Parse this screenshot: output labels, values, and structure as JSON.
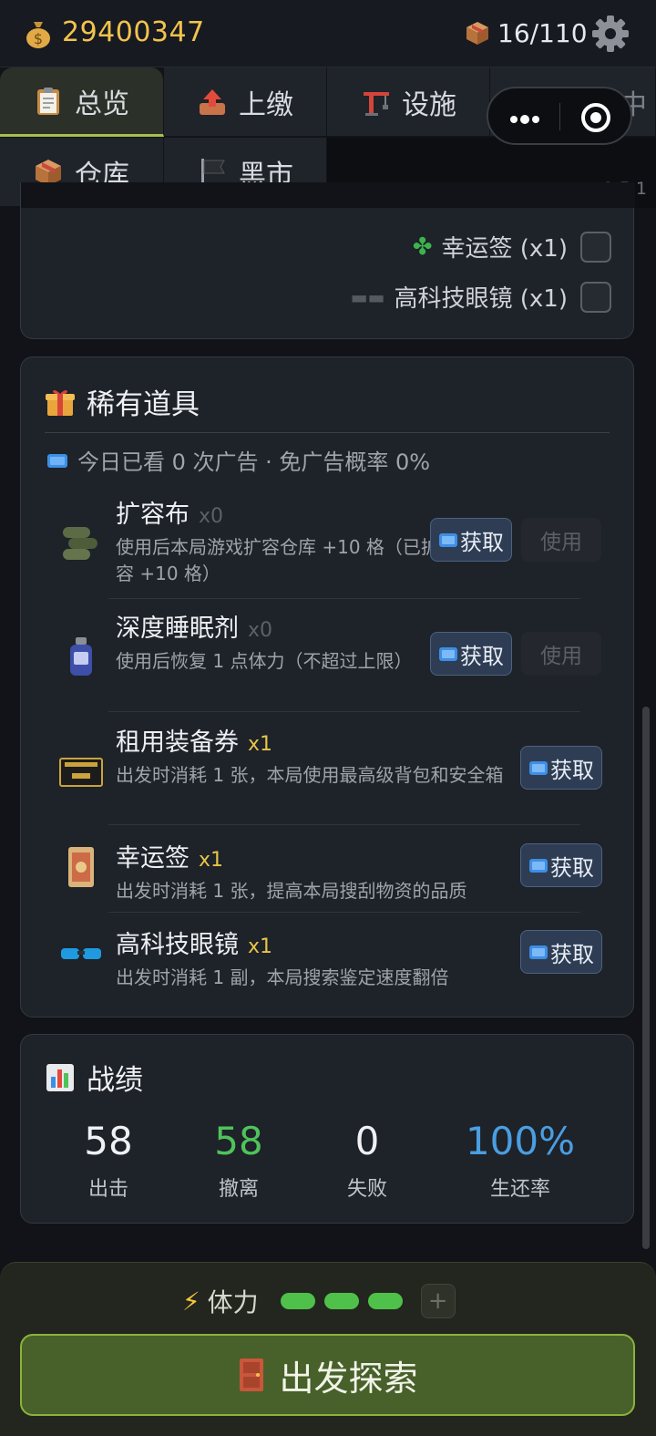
{
  "topbar": {
    "coins": "29400347",
    "capacity": "16/110",
    "icons": [
      "money-bag-icon",
      "box-icon",
      "gear-icon"
    ]
  },
  "tabs": [
    {
      "label": "总览",
      "icon": "clipboard-icon",
      "active": true
    },
    {
      "label": "上缴",
      "icon": "upload-icon",
      "active": false
    },
    {
      "label": "设施",
      "icon": "crane-icon",
      "active": false
    },
    {
      "label": "维修中",
      "icon": "construction-icon",
      "active": false
    },
    {
      "label": "仓库",
      "icon": "box-icon",
      "active": false
    },
    {
      "label": "黑市",
      "icon": "flag-icon",
      "active": false
    }
  ],
  "version": "v1.5.1",
  "checklist": [
    {
      "icon": "clover-icon",
      "label": "幸运签 (x1)"
    },
    {
      "icon": "sunglasses-icon",
      "label": "高科技眼镜 (x1)"
    }
  ],
  "rare": {
    "title": "稀有道具",
    "ad_info": "今日已看 0 次广告 · 免广告概率 0%",
    "get_label": "获取",
    "use_label": "使用",
    "items": [
      {
        "name": "扩容布",
        "qty": "x0",
        "desc": "使用后本局游戏扩容仓库 +10 格（已扩容 +10 格）",
        "icon": "fabric-roll-icon"
      },
      {
        "name": "深度睡眠剂",
        "qty": "x0",
        "desc": "使用后恢复 1 点体力（不超过上限）",
        "icon": "potion-bottle-icon"
      },
      {
        "name": "租用装备券",
        "qty": "x1",
        "desc": "出发时消耗 1 张，本局使用最高级背包和安全箱",
        "icon": "ticket-icon"
      },
      {
        "name": "幸运签",
        "qty": "x1",
        "desc": "出发时消耗 1 张，提高本局搜刮物资的品质",
        "icon": "lucky-charm-icon"
      },
      {
        "name": "高科技眼镜",
        "qty": "x1",
        "desc": "出发时消耗 1 副，本局搜索鉴定速度翻倍",
        "icon": "goggles-icon"
      }
    ]
  },
  "stats": {
    "title": "战绩",
    "items": [
      {
        "value": "58",
        "label": "出击",
        "color": "#f0f1f4"
      },
      {
        "value": "58",
        "label": "撤离",
        "color": "#4fc35a"
      },
      {
        "value": "0",
        "label": "失败",
        "color": "#f0f1f4"
      },
      {
        "value": "100%",
        "label": "生还率",
        "color": "#4a9ee0"
      }
    ]
  },
  "bottom": {
    "stamina_label": "体力",
    "stamina_filled": 3,
    "plus": "+",
    "go_label": "出发探索"
  }
}
